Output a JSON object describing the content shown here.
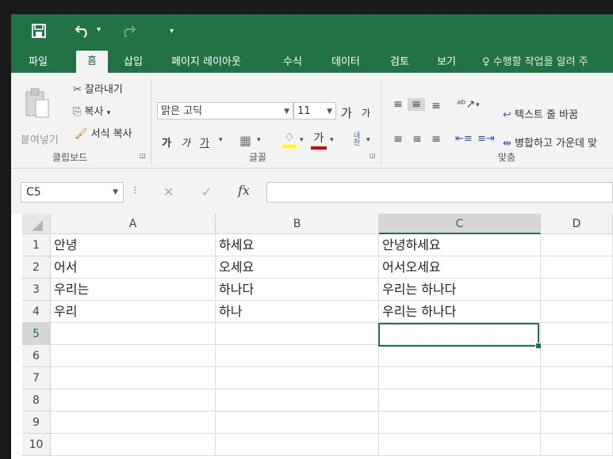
{
  "quick_access": {
    "save_icon": "save-icon",
    "undo_icon": "undo-icon",
    "redo_icon": "redo-icon",
    "customize_icon": "customize-qat-icon"
  },
  "tabs": [
    "파일",
    "홈",
    "삽입",
    "페이지 레이아웃",
    "수식",
    "데이터",
    "검토",
    "보기"
  ],
  "tell_me": "수행할 작업을 알려 주",
  "clipboard": {
    "paste": "붙여넣기",
    "cut": "잘라내기",
    "copy": "복사",
    "format_painter": "서식 복사",
    "group": "클립보드"
  },
  "font": {
    "name": "맑은 고딕",
    "size": "11",
    "grow": "가",
    "shrink": "가",
    "bold": "가",
    "italic": "가",
    "underline": "가",
    "color_glyph": "가",
    "phonetic": "내천",
    "group": "글꼴"
  },
  "alignment": {
    "wrap": "텍스트 줄 바꿈",
    "merge": "병합하고 가운데 맞",
    "group": "맞춤"
  },
  "formula_bar": {
    "name_box": "C5",
    "cancel": "✕",
    "enter": "✓",
    "fx": "fx",
    "value": ""
  },
  "columns": [
    "A",
    "B",
    "C",
    "D"
  ],
  "rows": [
    "1",
    "2",
    "3",
    "4",
    "5",
    "6",
    "7",
    "8",
    "9",
    "10"
  ],
  "cells": [
    [
      "안녕",
      "하세요",
      "안녕하세요"
    ],
    [
      "어서",
      "오세요",
      "어서오세요"
    ],
    [
      "우리는",
      "하나다",
      "우리는 하나다"
    ],
    [
      "우리",
      "하나",
      "우리는 하나다"
    ]
  ],
  "colors": {
    "accent": "#217346",
    "font_highlight": "#ffff00",
    "font_color": "#e00000"
  }
}
